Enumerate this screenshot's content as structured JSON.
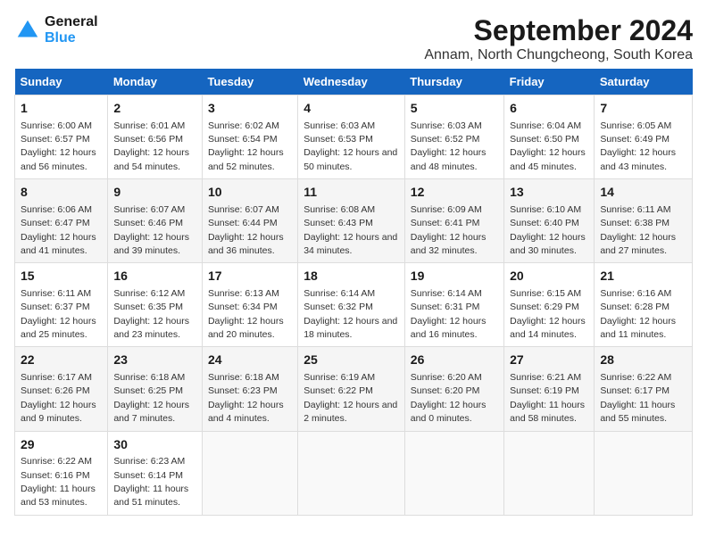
{
  "logo": {
    "line1": "General",
    "line2": "Blue"
  },
  "title": "September 2024",
  "subtitle": "Annam, North Chungcheong, South Korea",
  "weekdays": [
    "Sunday",
    "Monday",
    "Tuesday",
    "Wednesday",
    "Thursday",
    "Friday",
    "Saturday"
  ],
  "weeks": [
    [
      {
        "day": "1",
        "sunrise": "6:00 AM",
        "sunset": "6:57 PM",
        "daylight": "12 hours and 56 minutes."
      },
      {
        "day": "2",
        "sunrise": "6:01 AM",
        "sunset": "6:56 PM",
        "daylight": "12 hours and 54 minutes."
      },
      {
        "day": "3",
        "sunrise": "6:02 AM",
        "sunset": "6:54 PM",
        "daylight": "12 hours and 52 minutes."
      },
      {
        "day": "4",
        "sunrise": "6:03 AM",
        "sunset": "6:53 PM",
        "daylight": "12 hours and 50 minutes."
      },
      {
        "day": "5",
        "sunrise": "6:03 AM",
        "sunset": "6:52 PM",
        "daylight": "12 hours and 48 minutes."
      },
      {
        "day": "6",
        "sunrise": "6:04 AM",
        "sunset": "6:50 PM",
        "daylight": "12 hours and 45 minutes."
      },
      {
        "day": "7",
        "sunrise": "6:05 AM",
        "sunset": "6:49 PM",
        "daylight": "12 hours and 43 minutes."
      }
    ],
    [
      {
        "day": "8",
        "sunrise": "6:06 AM",
        "sunset": "6:47 PM",
        "daylight": "12 hours and 41 minutes."
      },
      {
        "day": "9",
        "sunrise": "6:07 AM",
        "sunset": "6:46 PM",
        "daylight": "12 hours and 39 minutes."
      },
      {
        "day": "10",
        "sunrise": "6:07 AM",
        "sunset": "6:44 PM",
        "daylight": "12 hours and 36 minutes."
      },
      {
        "day": "11",
        "sunrise": "6:08 AM",
        "sunset": "6:43 PM",
        "daylight": "12 hours and 34 minutes."
      },
      {
        "day": "12",
        "sunrise": "6:09 AM",
        "sunset": "6:41 PM",
        "daylight": "12 hours and 32 minutes."
      },
      {
        "day": "13",
        "sunrise": "6:10 AM",
        "sunset": "6:40 PM",
        "daylight": "12 hours and 30 minutes."
      },
      {
        "day": "14",
        "sunrise": "6:11 AM",
        "sunset": "6:38 PM",
        "daylight": "12 hours and 27 minutes."
      }
    ],
    [
      {
        "day": "15",
        "sunrise": "6:11 AM",
        "sunset": "6:37 PM",
        "daylight": "12 hours and 25 minutes."
      },
      {
        "day": "16",
        "sunrise": "6:12 AM",
        "sunset": "6:35 PM",
        "daylight": "12 hours and 23 minutes."
      },
      {
        "day": "17",
        "sunrise": "6:13 AM",
        "sunset": "6:34 PM",
        "daylight": "12 hours and 20 minutes."
      },
      {
        "day": "18",
        "sunrise": "6:14 AM",
        "sunset": "6:32 PM",
        "daylight": "12 hours and 18 minutes."
      },
      {
        "day": "19",
        "sunrise": "6:14 AM",
        "sunset": "6:31 PM",
        "daylight": "12 hours and 16 minutes."
      },
      {
        "day": "20",
        "sunrise": "6:15 AM",
        "sunset": "6:29 PM",
        "daylight": "12 hours and 14 minutes."
      },
      {
        "day": "21",
        "sunrise": "6:16 AM",
        "sunset": "6:28 PM",
        "daylight": "12 hours and 11 minutes."
      }
    ],
    [
      {
        "day": "22",
        "sunrise": "6:17 AM",
        "sunset": "6:26 PM",
        "daylight": "12 hours and 9 minutes."
      },
      {
        "day": "23",
        "sunrise": "6:18 AM",
        "sunset": "6:25 PM",
        "daylight": "12 hours and 7 minutes."
      },
      {
        "day": "24",
        "sunrise": "6:18 AM",
        "sunset": "6:23 PM",
        "daylight": "12 hours and 4 minutes."
      },
      {
        "day": "25",
        "sunrise": "6:19 AM",
        "sunset": "6:22 PM",
        "daylight": "12 hours and 2 minutes."
      },
      {
        "day": "26",
        "sunrise": "6:20 AM",
        "sunset": "6:20 PM",
        "daylight": "12 hours and 0 minutes."
      },
      {
        "day": "27",
        "sunrise": "6:21 AM",
        "sunset": "6:19 PM",
        "daylight": "11 hours and 58 minutes."
      },
      {
        "day": "28",
        "sunrise": "6:22 AM",
        "sunset": "6:17 PM",
        "daylight": "11 hours and 55 minutes."
      }
    ],
    [
      {
        "day": "29",
        "sunrise": "6:22 AM",
        "sunset": "6:16 PM",
        "daylight": "11 hours and 53 minutes."
      },
      {
        "day": "30",
        "sunrise": "6:23 AM",
        "sunset": "6:14 PM",
        "daylight": "11 hours and 51 minutes."
      },
      null,
      null,
      null,
      null,
      null
    ]
  ]
}
